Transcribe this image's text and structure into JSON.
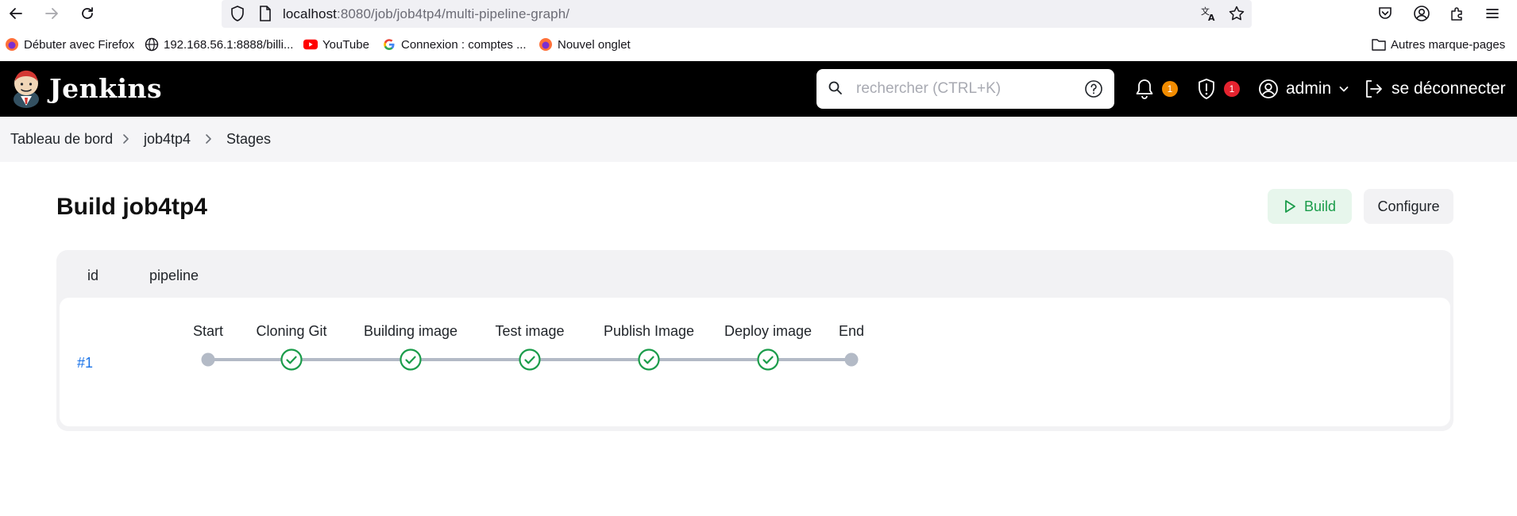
{
  "browser": {
    "url_host": "localhost",
    "url_rest": ":8080/job/job4tp4/multi-pipeline-graph/"
  },
  "bookmarks": [
    {
      "label": "Débuter avec Firefox",
      "icon": "firefox-icon"
    },
    {
      "label": "192.168.56.1:8888/billi...",
      "icon": "globe-icon"
    },
    {
      "label": "YouTube",
      "icon": "youtube-icon"
    },
    {
      "label": "Connexion : comptes ...",
      "icon": "google-icon"
    },
    {
      "label": "Nouvel onglet",
      "icon": "firefox-icon"
    }
  ],
  "bookmarks_other": "Autres marque-pages",
  "header": {
    "app_name": "Jenkins",
    "search_placeholder": "rechercher (CTRL+K)",
    "notifications_count": "1",
    "security_count": "1",
    "user": "admin",
    "logout": "se déconnecter"
  },
  "breadcrumb": [
    "Tableau de bord",
    "job4tp4",
    "Stages"
  ],
  "page": {
    "title": "Build job4tp4",
    "build_label": "Build",
    "configure_label": "Configure"
  },
  "table": {
    "columns": [
      "id",
      "pipeline"
    ],
    "rows": [
      {
        "id": "#1",
        "stages": [
          {
            "name": "Start",
            "status": "start"
          },
          {
            "name": "Cloning Git",
            "status": "success"
          },
          {
            "name": "Building image",
            "status": "success"
          },
          {
            "name": "Test image",
            "status": "success"
          },
          {
            "name": "Publish Image",
            "status": "success"
          },
          {
            "name": "Deploy image",
            "status": "success"
          },
          {
            "name": "End",
            "status": "end"
          }
        ]
      }
    ]
  },
  "colors": {
    "success": "#1a9c4a",
    "node_gray": "#b3bac6",
    "link": "#1a73e8",
    "badge_orange": "#f28c00",
    "badge_red": "#e5232f"
  }
}
